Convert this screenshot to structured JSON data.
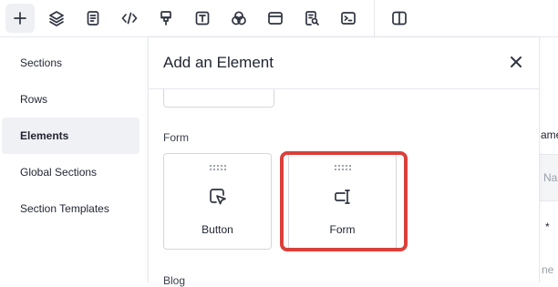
{
  "toolbar": {
    "items": [
      {
        "name": "add",
        "icon": "plus-icon"
      },
      {
        "name": "layers",
        "icon": "layers-icon"
      },
      {
        "name": "pages",
        "icon": "document-icon"
      },
      {
        "name": "code",
        "icon": "code-icon"
      },
      {
        "name": "brush",
        "icon": "brush-icon"
      },
      {
        "name": "text",
        "icon": "text-box-icon"
      },
      {
        "name": "colors",
        "icon": "circles-icon"
      },
      {
        "name": "browser",
        "icon": "browser-window-icon"
      },
      {
        "name": "seo",
        "icon": "search-document-icon"
      },
      {
        "name": "terminal",
        "icon": "terminal-icon"
      },
      {
        "name": "split-view",
        "icon": "columns-icon"
      }
    ]
  },
  "sidebar": {
    "items": [
      {
        "label": "Sections",
        "active": false
      },
      {
        "label": "Rows",
        "active": false
      },
      {
        "label": "Elements",
        "active": true
      },
      {
        "label": "Global Sections",
        "active": false
      },
      {
        "label": "Section Templates",
        "active": false
      }
    ]
  },
  "panel": {
    "title": "Add an Element",
    "sections": [
      {
        "label": "Form",
        "elements": [
          {
            "label": "Button",
            "icon": "cursor-click-icon"
          },
          {
            "label": "Form",
            "icon": "input-field-icon",
            "highlighted": true
          }
        ]
      },
      {
        "label": "Blog"
      }
    ]
  },
  "background_peek": {
    "text1": "ame",
    "text2": "Na",
    "text3": "*",
    "text4": "ne"
  },
  "colors": {
    "highlight": "#d9403a",
    "active_bg": "#f0f1f4"
  }
}
